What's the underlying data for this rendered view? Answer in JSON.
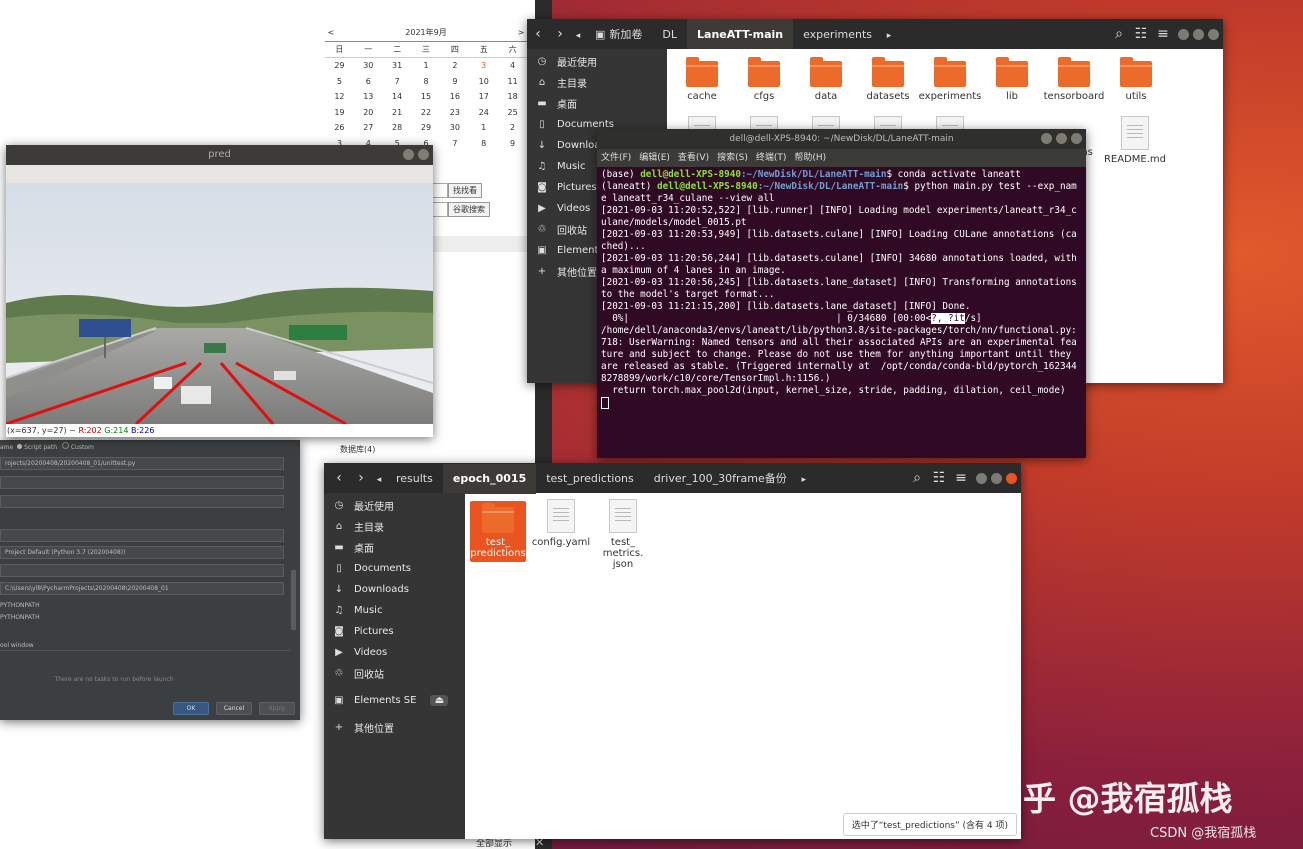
{
  "calendar": {
    "prev": "<",
    "month": "2021年9月",
    "next": ">",
    "weekdays": [
      "日",
      "一",
      "二",
      "三",
      "四",
      "五",
      "六"
    ],
    "weeks": [
      [
        "29",
        "30",
        "31",
        "1",
        "2",
        "3",
        "4"
      ],
      [
        "5",
        "6",
        "7",
        "8",
        "9",
        "10",
        "11"
      ],
      [
        "12",
        "13",
        "14",
        "15",
        "16",
        "17",
        "18"
      ],
      [
        "19",
        "20",
        "21",
        "22",
        "23",
        "24",
        "25"
      ],
      [
        "26",
        "27",
        "28",
        "29",
        "30",
        "1",
        "2"
      ],
      [
        "3",
        "4",
        "5",
        "6",
        "7",
        "8",
        "9"
      ]
    ]
  },
  "bg_page": {
    "search_button_1": "找找看",
    "search_button_2": "谷歌搜索",
    "db_link": "数据库(4)",
    "bottom_link": "全部显示"
  },
  "pred": {
    "title": "pred",
    "status": {
      "coords": "(x=637, y=27) ~ ",
      "r": "R:202",
      "g": "G:214",
      "b": "B:226"
    }
  },
  "pycharm": {
    "radio_name": "ame",
    "radio_script": "Script path",
    "radio_custom": "Custom",
    "script_path": "rojects/20200408/20200408_01/unittest.py",
    "interpreter": "Project Default (Python 3.7 (20200408))",
    "working_dir": "C:\\Users\\yl8\\PycharmProjects\\20200408\\20200408_01",
    "pythonpath_1": "PYTHONPATH",
    "pythonpath_2": "PYTHONPATH",
    "tool_window": "ool window",
    "no_tasks": "There are no tasks to run before launch",
    "ok": "OK",
    "cancel": "Cancel",
    "apply": "Apply"
  },
  "fm1": {
    "crumbs": [
      "新加卷",
      "DL",
      "LaneATT-main",
      "experiments"
    ],
    "sidebar": [
      "最近使用",
      "主目录",
      "桌面",
      "Documents",
      "Downloads",
      "Music",
      "Pictures",
      "Videos",
      "回收站",
      "Elements SE",
      "其他位置"
    ],
    "row1": [
      "cache",
      "cfgs",
      "data",
      "datasets",
      "experiments",
      "lib",
      "tensorboard",
      "utils"
    ],
    "row2_partial": "ons",
    "readme": "README.md"
  },
  "terminal": {
    "title": "dell@dell-XPS-8940: ~/NewDisk/DL/LaneATT-main",
    "menu": [
      "文件(F)",
      "编辑(E)",
      "查看(V)",
      "搜索(S)",
      "终端(T)",
      "帮助(H)"
    ],
    "l1_env": "(base) ",
    "l1_user": "dell@dell-XPS-8940",
    "l1_path": ":~/NewDisk/DL/LaneATT-main",
    "l1_cmd": "$ conda activate laneatt",
    "l2_env": "(laneatt) ",
    "l2_user": "dell@dell-XPS-8940",
    "l2_path": ":~/NewDisk/DL/LaneATT-main",
    "l2_cmd": "$ python main.py test --exp_name laneatt_r34_culane --view all",
    "log": [
      "[2021-09-03 11:20:52,522] [lib.runner] [INFO] Loading model experiments/laneatt_r34_culane/models/model_0015.pt",
      "[2021-09-03 11:20:53,949] [lib.datasets.culane] [INFO] Loading CULane annotations (cached)...",
      "[2021-09-03 11:20:56,244] [lib.datasets.culane] [INFO] 34680 annotations loaded, with a maximum of 4 lanes in an image.",
      "[2021-09-03 11:20:56,245] [lib.datasets.lane_dataset] [INFO] Transforming annotations to the model's target format...",
      "[2021-09-03 11:21:15,200] [lib.datasets.lane_dataset] [INFO] Done."
    ],
    "progress_a": "  0%|                                     | 0/34680 [00:00<",
    "progress_sel": "?, ?it",
    "progress_b": "/s]",
    "warning": "/home/dell/anaconda3/envs/laneatt/lib/python3.8/site-packages/torch/nn/functional.py:718: UserWarning: Named tensors and all their associated APIs are an experimental feature and subject to change. Please do not use them for anything important until they are released as stable. (Triggered internally at  /opt/conda/conda-bld/pytorch_1623448278899/work/c10/core/TensorImpl.h:1156.)",
    "return_line": "  return torch.max_pool2d(input, kernel_size, stride, padding, dilation, ceil_mode)"
  },
  "fm2": {
    "crumbs": [
      "results",
      "epoch_0015",
      "test_predictions",
      "driver_100_30frame备份"
    ],
    "sidebar": [
      "最近使用",
      "主目录",
      "桌面",
      "Documents",
      "Downloads",
      "Music",
      "Pictures",
      "Videos",
      "回收站",
      "Elements SE",
      "其他位置"
    ],
    "files": [
      {
        "name": "test_\npredictions",
        "type": "folder",
        "selected": true
      },
      {
        "name": "config.yaml",
        "type": "doc"
      },
      {
        "name": "test_\nmetrics.\njson",
        "type": "doc"
      }
    ],
    "status": "选中了“test_predictions” (含有 4 项)"
  },
  "watermark": {
    "zhihu": "知乎 @我宿孤栈",
    "csdn": "CSDN @我宿孤栈"
  }
}
